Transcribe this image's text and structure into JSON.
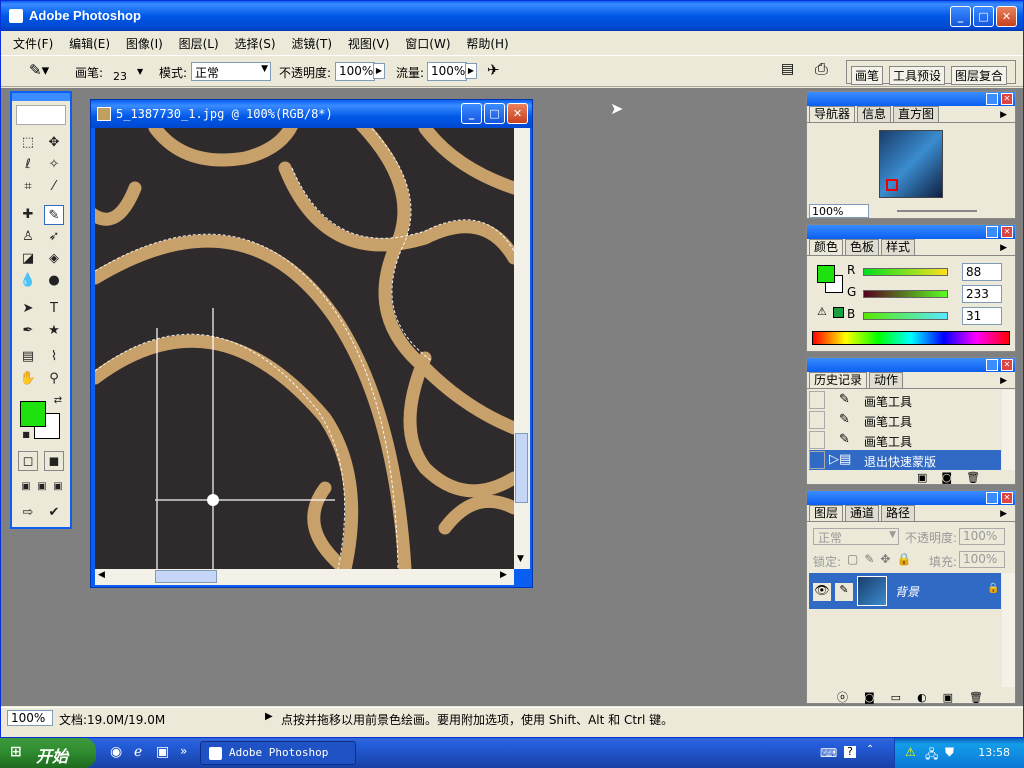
{
  "app": {
    "title": "Adobe Photoshop"
  },
  "menu": [
    "文件(F)",
    "编辑(E)",
    "图像(I)",
    "图层(L)",
    "选择(S)",
    "滤镜(T)",
    "视图(V)",
    "窗口(W)",
    "帮助(H)"
  ],
  "options": {
    "brush_label": "画笔:",
    "brush_size": "23",
    "mode_label": "模式:",
    "mode_value": "正常",
    "opacity_label": "不透明度:",
    "opacity_value": "100%",
    "flow_label": "流量:",
    "flow_value": "100%",
    "palette_tabs": [
      "画笔",
      "工具预设",
      "图层复合"
    ]
  },
  "document": {
    "title": "5_1387730_1.jpg @ 100%(RGB/8*)"
  },
  "navigator": {
    "tabs": [
      "导航器",
      "信息",
      "直方图"
    ],
    "zoom": "100%"
  },
  "color": {
    "tabs": [
      "颜色",
      "色板",
      "样式"
    ],
    "r_label": "R",
    "r_value": "88",
    "g_label": "G",
    "g_value": "233",
    "b_label": "B",
    "b_value": "31",
    "foreground": "#1de20e"
  },
  "history": {
    "tabs": [
      "历史记录",
      "动作"
    ],
    "items": [
      "画笔工具",
      "画笔工具",
      "画笔工具",
      "退出快速蒙版"
    ]
  },
  "layers": {
    "tabs": [
      "图层",
      "通道",
      "路径"
    ],
    "blend": "正常",
    "opacity_label": "不透明度:",
    "opacity_value": "100%",
    "lock_label": "锁定:",
    "fill_label": "填充:",
    "fill_value": "100%",
    "layer_name": "背景"
  },
  "status": {
    "zoom": "100%",
    "doc": "文档:19.0M/19.0M",
    "hint": "点按并拖移以用前景色绘画。要用附加选项，使用 Shift、Alt 和 Ctrl 键。"
  },
  "taskbar": {
    "start": "开始",
    "task": "Adobe Photoshop",
    "clock": "13:58"
  }
}
